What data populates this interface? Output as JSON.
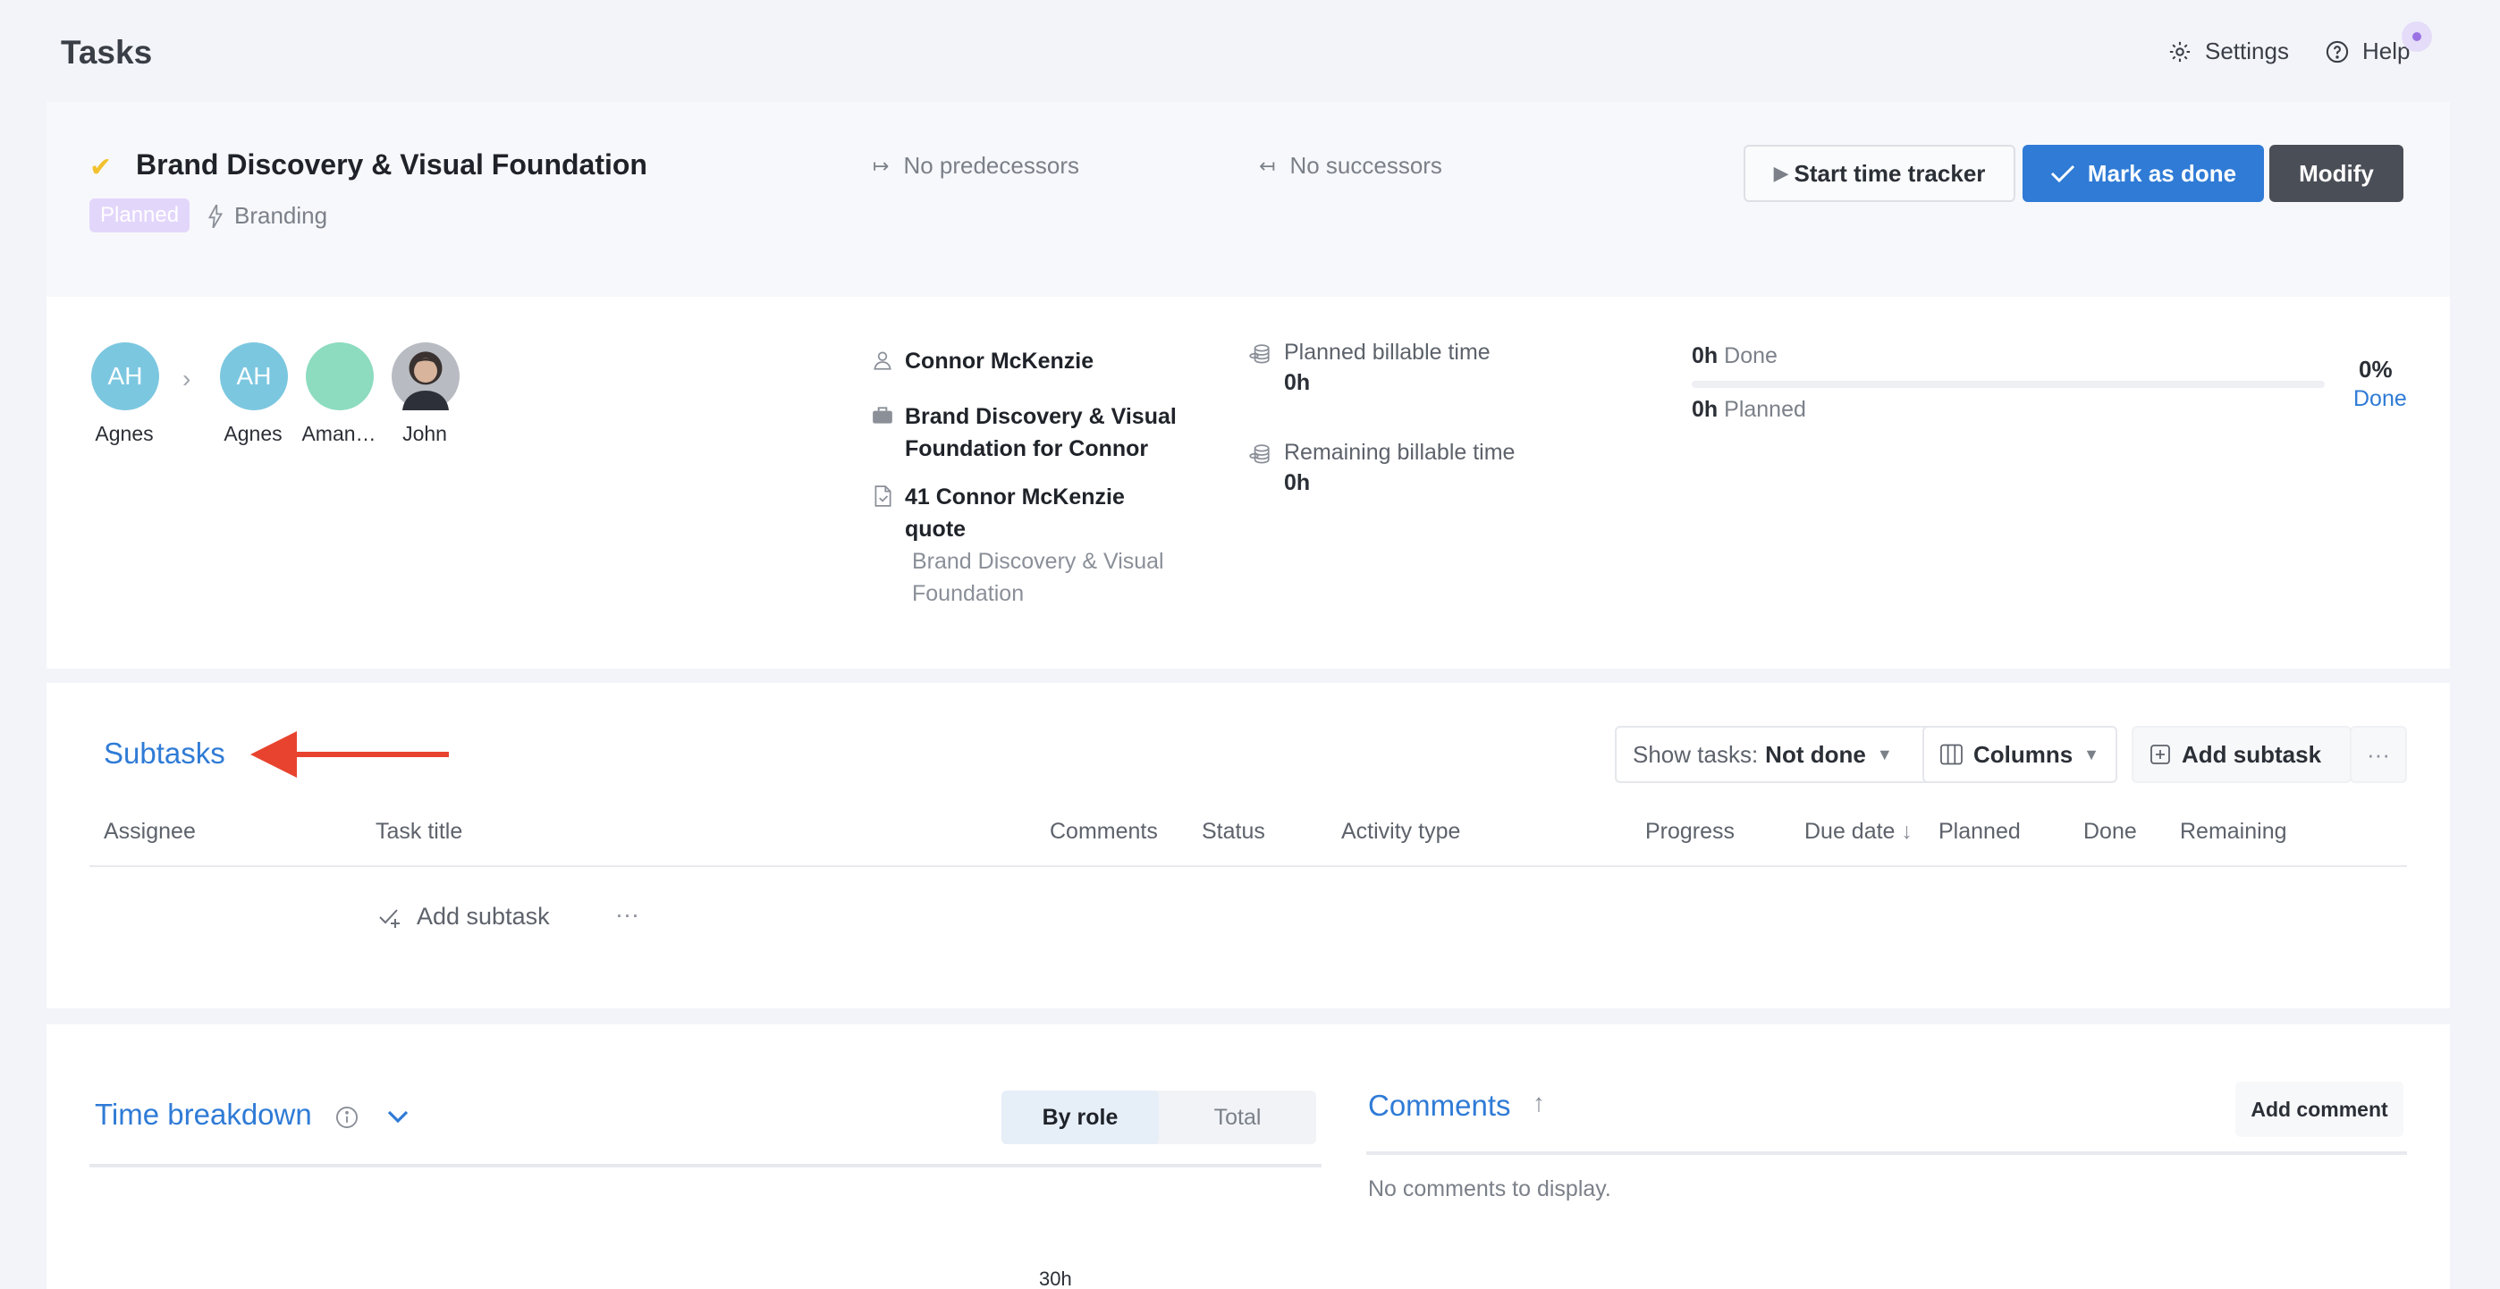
{
  "page": {
    "title": "Tasks"
  },
  "topbar": {
    "settings_label": "Settings",
    "help_label": "Help"
  },
  "task": {
    "title": "Brand Discovery & Visual Foundation",
    "status_badge": "Planned",
    "category": "Branding",
    "predecessors": "No predecessors",
    "successors": "No successors",
    "actions": {
      "start_tracker": "Start time tracker",
      "mark_done": "Mark as done",
      "modify": "Modify"
    }
  },
  "assignees": {
    "from": {
      "initials": "AH",
      "name": "Agnes",
      "color": "#7cc7e0"
    },
    "to": [
      {
        "initials": "AH",
        "name": "Agnes",
        "color": "#7cc7e0"
      },
      {
        "initials": "",
        "name": "Aman…",
        "color": "#8ddcbf"
      },
      {
        "initials": "",
        "name": "John",
        "color": "#5a5a5a"
      }
    ]
  },
  "details": {
    "client": "Connor McKenzie",
    "project_line1": "Brand Discovery & Visual",
    "project_line2": "Foundation for Connor",
    "quote_line1": "41 Connor McKenzie",
    "quote_line2": "quote",
    "quote_sub_line1": "Brand Discovery & Visual",
    "quote_sub_line2": "Foundation"
  },
  "billing": {
    "planned_label": "Planned billable time",
    "planned_value": "0h",
    "remaining_label": "Remaining billable time",
    "remaining_value": "0h"
  },
  "progress": {
    "done_value": "0h",
    "done_label": "Done",
    "planned_value": "0h",
    "planned_label": "Planned",
    "percent": "0%",
    "percent_label": "Done"
  },
  "subtasks": {
    "title": "Subtasks",
    "show_tasks_label": "Show tasks:",
    "show_tasks_value": "Not done",
    "columns_label": "Columns",
    "add_label": "Add subtask",
    "more_label": "···",
    "columns": [
      "Assignee",
      "Task title",
      "Comments",
      "Status",
      "Activity type",
      "Progress",
      "Due date",
      "Planned",
      "Done",
      "Remaining"
    ],
    "add_row_label": "Add subtask",
    "add_row_more": "···"
  },
  "time_breakdown": {
    "title": "Time breakdown",
    "tabs": [
      "By role",
      "Total"
    ],
    "axis_top": "30h"
  },
  "comments": {
    "title": "Comments",
    "add_label": "Add comment",
    "empty": "No comments to display."
  },
  "colors": {
    "accent": "#2f7bd6",
    "annotation_arrow": "#e8432e",
    "badge_bg": "#e3d6fb"
  }
}
